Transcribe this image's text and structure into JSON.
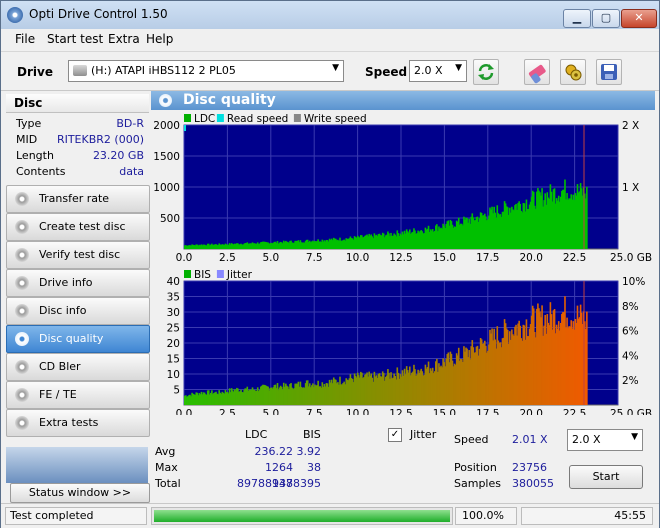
{
  "window": {
    "title": "Opti Drive Control 1.50",
    "min_label": "▁",
    "max_label": "▢",
    "close_label": "✕"
  },
  "menu": [
    "File",
    "Start test",
    "Extra",
    "Help"
  ],
  "toolbar": {
    "drive_label": "Drive",
    "drive_value": "(H:)   ATAPI iHBS112   2 PL05",
    "speed_label": "Speed",
    "speed_value": "2.0 X",
    "buttons": [
      "refresh-icon",
      "eraser-icon",
      "sun-gear-icon",
      "save-icon"
    ]
  },
  "disc": {
    "header": "Disc",
    "rows": [
      {
        "key": "Type",
        "value": "BD-R"
      },
      {
        "key": "MID",
        "value": "RITEKBR2 (000)"
      },
      {
        "key": "Length",
        "value": "23.20 GB"
      },
      {
        "key": "Contents",
        "value": "data"
      }
    ]
  },
  "nav": [
    {
      "label": "Transfer rate",
      "active": false
    },
    {
      "label": "Create test disc",
      "active": false
    },
    {
      "label": "Verify test disc",
      "active": false
    },
    {
      "label": "Drive info",
      "active": false
    },
    {
      "label": "Disc info",
      "active": false
    },
    {
      "label": "Disc quality",
      "active": true
    },
    {
      "label": "CD Bler",
      "active": false
    },
    {
      "label": "FE / TE",
      "active": false
    },
    {
      "label": "Extra tests",
      "active": false
    }
  ],
  "status_window_label": "Status window >>",
  "panel_title": "Disc quality",
  "chart_data": [
    {
      "type": "area",
      "legend": [
        {
          "name": "LDC",
          "color": "#00b000"
        },
        {
          "name": "Read speed",
          "color": "#00e0e0"
        },
        {
          "name": "Write speed",
          "color": "#888888"
        }
      ],
      "x_ticks": [
        "0.0",
        "2.5",
        "5.0",
        "7.5",
        "10.0",
        "12.5",
        "15.0",
        "17.5",
        "20.0",
        "22.5",
        "25.0 GB"
      ],
      "y_ticks_left": [
        "2000",
        "1500",
        "1000",
        "500"
      ],
      "y_ticks_right": [
        "2 X",
        "1 X"
      ],
      "xlim": [
        0,
        25
      ],
      "ylim": [
        0,
        2000
      ],
      "series": [
        {
          "name": "LDC",
          "x": [
            0,
            1,
            2,
            3,
            4,
            5,
            6,
            7,
            8,
            9,
            10,
            11,
            12,
            13,
            14,
            15,
            16,
            17,
            18,
            19,
            20,
            21,
            22,
            23.2
          ],
          "values": [
            60,
            70,
            75,
            85,
            95,
            105,
            115,
            130,
            145,
            160,
            185,
            215,
            245,
            280,
            320,
            380,
            440,
            520,
            610,
            700,
            790,
            880,
            960,
            900
          ]
        }
      ]
    },
    {
      "type": "bar",
      "legend": [
        {
          "name": "BIS",
          "color": "#00b000"
        },
        {
          "name": "Jitter",
          "color": "#8888ff"
        }
      ],
      "x_ticks": [
        "0.0",
        "2.5",
        "5.0",
        "7.5",
        "10.0",
        "12.5",
        "15.0",
        "17.5",
        "20.0",
        "22.5",
        "25.0 GB"
      ],
      "y_ticks_left": [
        "40",
        "35",
        "30",
        "25",
        "20",
        "15",
        "10",
        "5"
      ],
      "y_ticks_right": [
        "10%",
        "8%",
        "6%",
        "4%",
        "2%"
      ],
      "xlim": [
        0,
        25
      ],
      "ylim": [
        0,
        40
      ],
      "series": [
        {
          "name": "BIS",
          "x": [
            0,
            1,
            2,
            3,
            4,
            5,
            6,
            7,
            8,
            9,
            10,
            11,
            12,
            13,
            14,
            15,
            16,
            17,
            18,
            19,
            20,
            21,
            22,
            23.2
          ],
          "values": [
            3,
            4,
            4,
            5,
            5,
            6,
            6,
            7,
            7,
            8,
            9,
            9,
            10,
            11,
            12,
            14,
            16,
            19,
            22,
            25,
            27,
            28,
            30,
            27
          ]
        }
      ]
    }
  ],
  "stats": {
    "col_ldc": "LDC",
    "col_bis": "BIS",
    "rows": [
      {
        "label": "Avg",
        "ldc": "236.22",
        "bis": "3.92"
      },
      {
        "label": "Max",
        "ldc": "1264",
        "bis": "38"
      },
      {
        "label": "Total",
        "ldc": "89788937",
        "bis": "1488395"
      }
    ],
    "jitter_label": "Jitter",
    "speed_label": "Speed",
    "speed_value": "2.01 X",
    "speed_select": "2.0 X",
    "position_label": "Position",
    "position_value": "23756",
    "samples_label": "Samples",
    "samples_value": "380055",
    "start_label": "Start"
  },
  "statusbar": {
    "text": "Test completed",
    "progress": 1.0,
    "progress_label": "100.0%",
    "time": "45:55"
  }
}
